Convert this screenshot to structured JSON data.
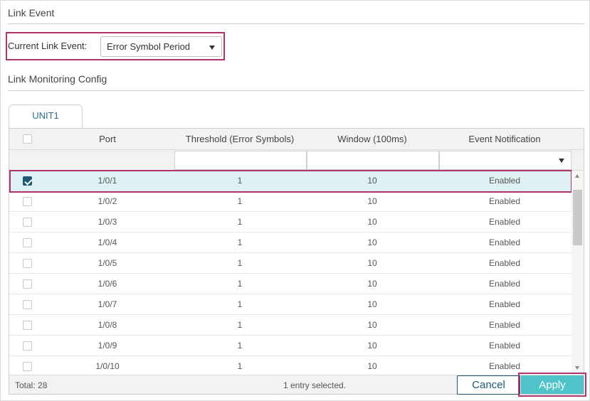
{
  "link_event": {
    "title": "Link Event",
    "current_label": "Current Link Event:",
    "current_value": "Error Symbol Period"
  },
  "monitoring": {
    "title": "Link Monitoring Config"
  },
  "tabs": [
    {
      "label": "UNIT1",
      "active": true
    }
  ],
  "table": {
    "columns": [
      "Port",
      "Threshold (Error Symbols)",
      "Window (100ms)",
      "Event Notification"
    ],
    "rows": [
      {
        "checked": true,
        "port": "1/0/1",
        "threshold": "1",
        "window": "10",
        "notification": "Enabled"
      },
      {
        "checked": false,
        "port": "1/0/2",
        "threshold": "1",
        "window": "10",
        "notification": "Enabled"
      },
      {
        "checked": false,
        "port": "1/0/3",
        "threshold": "1",
        "window": "10",
        "notification": "Enabled"
      },
      {
        "checked": false,
        "port": "1/0/4",
        "threshold": "1",
        "window": "10",
        "notification": "Enabled"
      },
      {
        "checked": false,
        "port": "1/0/5",
        "threshold": "1",
        "window": "10",
        "notification": "Enabled"
      },
      {
        "checked": false,
        "port": "1/0/6",
        "threshold": "1",
        "window": "10",
        "notification": "Enabled"
      },
      {
        "checked": false,
        "port": "1/0/7",
        "threshold": "1",
        "window": "10",
        "notification": "Enabled"
      },
      {
        "checked": false,
        "port": "1/0/8",
        "threshold": "1",
        "window": "10",
        "notification": "Enabled"
      },
      {
        "checked": false,
        "port": "1/0/9",
        "threshold": "1",
        "window": "10",
        "notification": "Enabled"
      },
      {
        "checked": false,
        "port": "1/0/10",
        "threshold": "1",
        "window": "10",
        "notification": "Enabled"
      }
    ],
    "total_text": "Total: 28",
    "selection_text": "1 entry selected."
  },
  "buttons": {
    "cancel": "Cancel",
    "apply": "Apply"
  },
  "colors": {
    "accent": "#1e5a73",
    "apply": "#4ec4c9",
    "highlight": "#b0336d",
    "selected_row": "#dff1f2"
  },
  "icons": [
    "dropdown-caret-icon",
    "checkbox-icon",
    "scroll-up-arrow-icon",
    "scroll-down-arrow-icon"
  ]
}
